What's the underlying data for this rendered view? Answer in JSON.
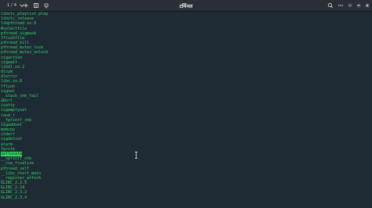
{
  "titlebar": {
    "tab_counter": "1 / 4",
    "title": "टर्मिनल",
    "icons": {
      "tab_chevron": "chevron-down-icon",
      "new_tab": "plus-icon",
      "split": "split-view-icon",
      "pin": "pin-icon",
      "search": "search-icon",
      "menu": "more-icon",
      "minimize": "minimize-icon",
      "maximize": "maximize-icon",
      "close": "close-icon"
    }
  },
  "terminal": {
    "lines": [
      "libvlc_playlist_play",
      "libvlc_release",
      "libpthread.so.0",
      "#selectfile",
      "pthread_sigmask",
      "fflushfile",
      "pthread_kill",
      "pthread_mutex_lock",
      "pthread_mutex_unlock",
      "sigaction",
      "sigwait",
      "libdl.so.2",
      "dlsym",
      "dlerror",
      "libc.so.6",
      "fflush",
      "signal",
      "__stack_chk_fail",
      "abort",
      "isatty",
      "sigemptyset",
      "rand_r",
      "__fprintf_chk",
      "sigaddset",
      "memcpy",
      "stderr",
      "sigdelset",
      "alarm",
      "fwrite",
      "setlocale",
      "__sprintf_chk",
      "__cxa_finalize",
      "pthread_self",
      "__libc_start_main",
      "__register_atfork",
      "GLIBC_2.2.5",
      "GLIBC_2.14",
      "GLIBC_2.3.2",
      "GLIBC_2.3.4"
    ],
    "highlighted_line": "setlocale",
    "text_color": "#35d36b"
  }
}
